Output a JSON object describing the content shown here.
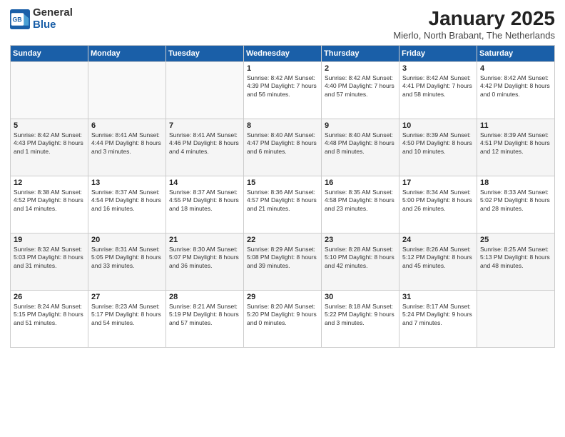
{
  "header": {
    "logo_general": "General",
    "logo_blue": "Blue",
    "month": "January 2025",
    "location": "Mierlo, North Brabant, The Netherlands"
  },
  "days_of_week": [
    "Sunday",
    "Monday",
    "Tuesday",
    "Wednesday",
    "Thursday",
    "Friday",
    "Saturday"
  ],
  "weeks": [
    [
      {
        "day": "",
        "info": ""
      },
      {
        "day": "",
        "info": ""
      },
      {
        "day": "",
        "info": ""
      },
      {
        "day": "1",
        "info": "Sunrise: 8:42 AM\nSunset: 4:39 PM\nDaylight: 7 hours and 56 minutes."
      },
      {
        "day": "2",
        "info": "Sunrise: 8:42 AM\nSunset: 4:40 PM\nDaylight: 7 hours and 57 minutes."
      },
      {
        "day": "3",
        "info": "Sunrise: 8:42 AM\nSunset: 4:41 PM\nDaylight: 7 hours and 58 minutes."
      },
      {
        "day": "4",
        "info": "Sunrise: 8:42 AM\nSunset: 4:42 PM\nDaylight: 8 hours and 0 minutes."
      }
    ],
    [
      {
        "day": "5",
        "info": "Sunrise: 8:42 AM\nSunset: 4:43 PM\nDaylight: 8 hours and 1 minute."
      },
      {
        "day": "6",
        "info": "Sunrise: 8:41 AM\nSunset: 4:44 PM\nDaylight: 8 hours and 3 minutes."
      },
      {
        "day": "7",
        "info": "Sunrise: 8:41 AM\nSunset: 4:46 PM\nDaylight: 8 hours and 4 minutes."
      },
      {
        "day": "8",
        "info": "Sunrise: 8:40 AM\nSunset: 4:47 PM\nDaylight: 8 hours and 6 minutes."
      },
      {
        "day": "9",
        "info": "Sunrise: 8:40 AM\nSunset: 4:48 PM\nDaylight: 8 hours and 8 minutes."
      },
      {
        "day": "10",
        "info": "Sunrise: 8:39 AM\nSunset: 4:50 PM\nDaylight: 8 hours and 10 minutes."
      },
      {
        "day": "11",
        "info": "Sunrise: 8:39 AM\nSunset: 4:51 PM\nDaylight: 8 hours and 12 minutes."
      }
    ],
    [
      {
        "day": "12",
        "info": "Sunrise: 8:38 AM\nSunset: 4:52 PM\nDaylight: 8 hours and 14 minutes."
      },
      {
        "day": "13",
        "info": "Sunrise: 8:37 AM\nSunset: 4:54 PM\nDaylight: 8 hours and 16 minutes."
      },
      {
        "day": "14",
        "info": "Sunrise: 8:37 AM\nSunset: 4:55 PM\nDaylight: 8 hours and 18 minutes."
      },
      {
        "day": "15",
        "info": "Sunrise: 8:36 AM\nSunset: 4:57 PM\nDaylight: 8 hours and 21 minutes."
      },
      {
        "day": "16",
        "info": "Sunrise: 8:35 AM\nSunset: 4:58 PM\nDaylight: 8 hours and 23 minutes."
      },
      {
        "day": "17",
        "info": "Sunrise: 8:34 AM\nSunset: 5:00 PM\nDaylight: 8 hours and 26 minutes."
      },
      {
        "day": "18",
        "info": "Sunrise: 8:33 AM\nSunset: 5:02 PM\nDaylight: 8 hours and 28 minutes."
      }
    ],
    [
      {
        "day": "19",
        "info": "Sunrise: 8:32 AM\nSunset: 5:03 PM\nDaylight: 8 hours and 31 minutes."
      },
      {
        "day": "20",
        "info": "Sunrise: 8:31 AM\nSunset: 5:05 PM\nDaylight: 8 hours and 33 minutes."
      },
      {
        "day": "21",
        "info": "Sunrise: 8:30 AM\nSunset: 5:07 PM\nDaylight: 8 hours and 36 minutes."
      },
      {
        "day": "22",
        "info": "Sunrise: 8:29 AM\nSunset: 5:08 PM\nDaylight: 8 hours and 39 minutes."
      },
      {
        "day": "23",
        "info": "Sunrise: 8:28 AM\nSunset: 5:10 PM\nDaylight: 8 hours and 42 minutes."
      },
      {
        "day": "24",
        "info": "Sunrise: 8:26 AM\nSunset: 5:12 PM\nDaylight: 8 hours and 45 minutes."
      },
      {
        "day": "25",
        "info": "Sunrise: 8:25 AM\nSunset: 5:13 PM\nDaylight: 8 hours and 48 minutes."
      }
    ],
    [
      {
        "day": "26",
        "info": "Sunrise: 8:24 AM\nSunset: 5:15 PM\nDaylight: 8 hours and 51 minutes."
      },
      {
        "day": "27",
        "info": "Sunrise: 8:23 AM\nSunset: 5:17 PM\nDaylight: 8 hours and 54 minutes."
      },
      {
        "day": "28",
        "info": "Sunrise: 8:21 AM\nSunset: 5:19 PM\nDaylight: 8 hours and 57 minutes."
      },
      {
        "day": "29",
        "info": "Sunrise: 8:20 AM\nSunset: 5:20 PM\nDaylight: 9 hours and 0 minutes."
      },
      {
        "day": "30",
        "info": "Sunrise: 8:18 AM\nSunset: 5:22 PM\nDaylight: 9 hours and 3 minutes."
      },
      {
        "day": "31",
        "info": "Sunrise: 8:17 AM\nSunset: 5:24 PM\nDaylight: 9 hours and 7 minutes."
      },
      {
        "day": "",
        "info": ""
      }
    ]
  ]
}
